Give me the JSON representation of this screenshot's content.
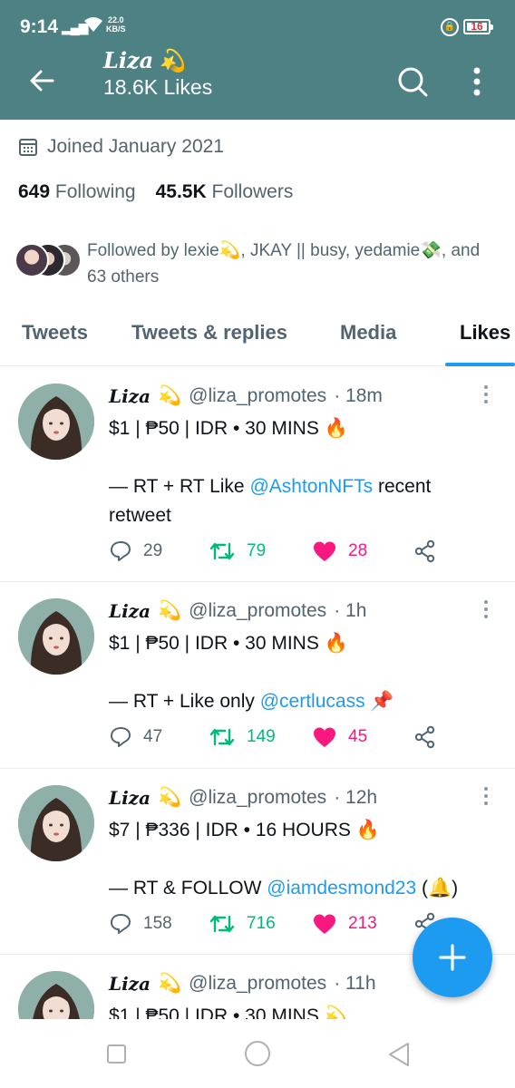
{
  "status_bar": {
    "time": "9:14",
    "speed_value": "22.0",
    "speed_unit": "KB/S",
    "battery": "16"
  },
  "header": {
    "name": "Liza",
    "subtitle": "18.6K Likes"
  },
  "profile": {
    "joined": "Joined January 2021",
    "following_count": "649",
    "following_label": "Following",
    "followers_count": "45.5K",
    "followers_label": "Followers",
    "followed_by": "Followed by lexie💫, JKAY || busy, yedamie💸, and 63 others"
  },
  "tabs": [
    {
      "label": "Tweets"
    },
    {
      "label": "Tweets & replies"
    },
    {
      "label": "Media"
    },
    {
      "label": "Likes"
    }
  ],
  "tweets": [
    {
      "name": "Liza",
      "handle": "@liza_promotes",
      "time": "· 18m",
      "line1": "$1 | ₱50 | IDR • 30 MINS 🔥",
      "line2_prefix": "— RT + RT Like ",
      "line2_mention": "@AshtonNFTs",
      "line2_suffix": " recent",
      "line3": "retweet",
      "replies": "29",
      "retweets": "79",
      "likes": "28"
    },
    {
      "name": "Liza",
      "handle": "@liza_promotes",
      "time": "· 1h",
      "line1": "$1 | ₱50 | IDR • 30 MINS 🔥",
      "line2_prefix": "— RT + Like only ",
      "line2_mention": "@certlucass",
      "line2_suffix": " 📌",
      "replies": "47",
      "retweets": "149",
      "likes": "45"
    },
    {
      "name": "Liza",
      "handle": "@liza_promotes",
      "time": "· 12h",
      "line1": "$7 | ₱336 | IDR • 16 HOURS 🔥",
      "line2_prefix": "— RT & FOLLOW ",
      "line2_mention": "@iamdesmond23",
      "line2_suffix": " (🔔)",
      "replies": "158",
      "retweets": "716",
      "likes": "213"
    },
    {
      "name": "Liza",
      "handle": "@liza_promotes",
      "time": "· 11h",
      "line1": "$1 | ₱50 | IDR • 30 MINS 💫"
    }
  ],
  "colors": {
    "header_bg": "#4d8184",
    "accent": "#1d9bf0",
    "retweet": "#00ba7c",
    "like": "#f91880",
    "muted": "#536471"
  },
  "icons": [
    "back-arrow-icon",
    "search-icon",
    "more-vertical-icon",
    "calendar-icon",
    "reply-icon",
    "retweet-icon",
    "heart-icon",
    "share-icon",
    "compose-plus-icon",
    "shooting-star-icon"
  ]
}
